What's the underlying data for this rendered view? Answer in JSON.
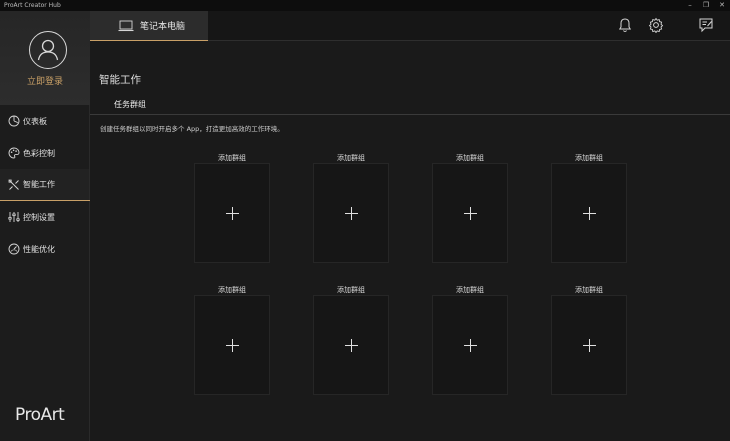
{
  "window": {
    "title": "ProArt Creator Hub",
    "minimize_glyph": "–",
    "maximize_glyph": "❐",
    "close_glyph": "✕"
  },
  "sidebar": {
    "login_label": "立即登录",
    "items": [
      {
        "label": "仪表板",
        "icon": "dashboard-icon"
      },
      {
        "label": "色彩控制",
        "icon": "palette-icon"
      },
      {
        "label": "智能工作",
        "icon": "tools-icon",
        "active": true
      },
      {
        "label": "控制设置",
        "icon": "sliders-icon"
      },
      {
        "label": "性能优化",
        "icon": "gauge-icon"
      }
    ],
    "brand": "ProArt"
  },
  "topbar": {
    "device_tab_label": "笔记本电脑",
    "icons": [
      "bell-icon",
      "gear-icon",
      "feedback-icon"
    ]
  },
  "main": {
    "title": "智能工作",
    "subtab_label": "任务群组",
    "description": "创建任务群组以同时开启多个 App，打造更加高效的工作环境。",
    "groups": [
      {
        "label": "添加群组"
      },
      {
        "label": "添加群组"
      },
      {
        "label": "添加群组"
      },
      {
        "label": "添加群组"
      },
      {
        "label": "添加群组"
      },
      {
        "label": "添加群组"
      },
      {
        "label": "添加群组"
      },
      {
        "label": "添加群组"
      }
    ]
  },
  "colors": {
    "accent": "#c9a067",
    "background": "#1a1a1a"
  }
}
